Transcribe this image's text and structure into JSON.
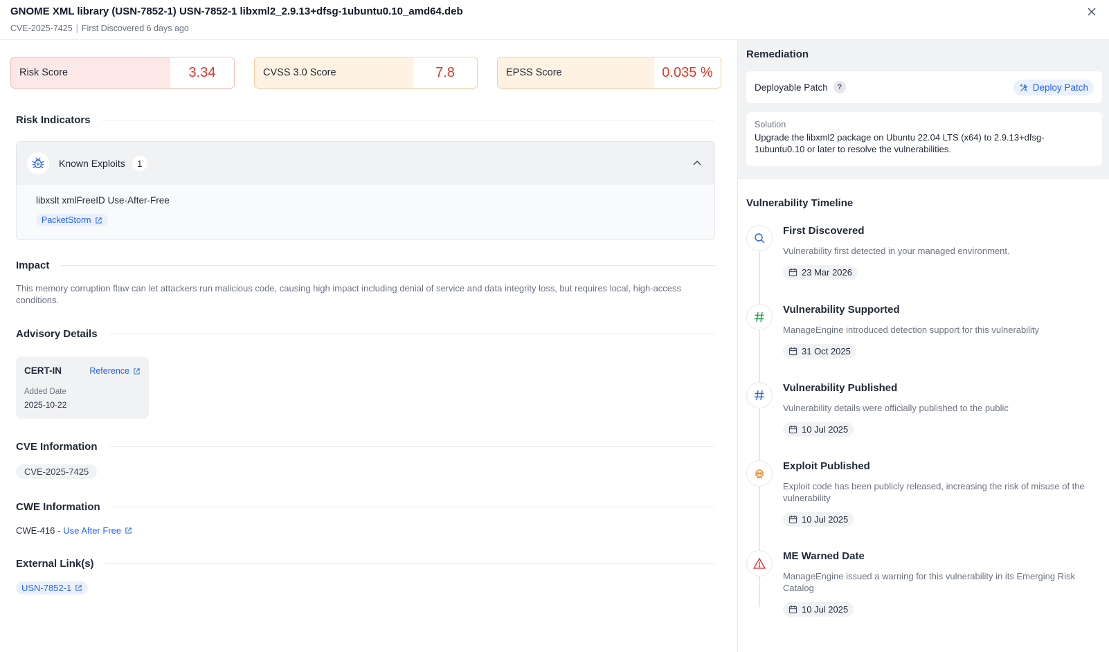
{
  "header": {
    "title": "GNOME XML library (USN-7852-1) USN-7852-1 libxml2_2.9.13+dfsg-1ubuntu0.10_amd64.deb",
    "cve_id": "CVE-2025-7425",
    "separator": "|",
    "discovered": "First Discovered 6 days ago",
    "close_icon": "close-icon"
  },
  "scores": {
    "risk": {
      "label": "Risk Score",
      "value": "3.34"
    },
    "cvss": {
      "label": "CVSS 3.0 Score",
      "value": "7.8"
    },
    "epss": {
      "label": "EPSS Score",
      "value": "0.035 %"
    },
    "colors": {
      "value": "#d93a2b",
      "risk_bg": "#fce8e6",
      "warn_bg": "#fef3e2"
    }
  },
  "risk_indicators": {
    "title": "Risk Indicators",
    "known_exploits": {
      "label": "Known Exploits",
      "count": "1",
      "icon": "bug-icon",
      "items": [
        {
          "title": "libxslt xmlFreeID Use-After-Free",
          "source": "PacketStorm"
        }
      ]
    }
  },
  "impact": {
    "title": "Impact",
    "text": "This memory corruption flaw can let attackers run malicious code, causing high impact including denial of service and data integrity loss, but requires local, high-access conditions."
  },
  "advisory": {
    "title": "Advisory Details",
    "items": [
      {
        "org": "CERT-IN",
        "link_label": "Reference",
        "date_label": "Added Date",
        "date": "2025-10-22"
      }
    ]
  },
  "cve_info": {
    "title": "CVE Information",
    "ids": [
      "CVE-2025-7425"
    ]
  },
  "cwe_info": {
    "title": "CWE Information",
    "id": "CWE-416 -",
    "name": "Use After Free"
  },
  "external_links": {
    "title": "External Link(s)",
    "links": [
      "USN-7852-1"
    ]
  },
  "remediation": {
    "title": "Remediation",
    "patch_label": "Deployable Patch",
    "help": "?",
    "deploy_button": "Deploy Patch",
    "solution_label": "Solution",
    "solution_text": "Upgrade the libxml2 package on Ubuntu 22.04 LTS (x64) to 2.9.13+dfsg-1ubuntu0.10 or later to resolve the vulnerabilities."
  },
  "timeline": {
    "title": "Vulnerability Timeline",
    "items": [
      {
        "title": "First Discovered",
        "desc": "Vulnerability first detected in your managed environment.",
        "date": "23 Mar 2026",
        "icon": "search-icon",
        "color": "#2563eb"
      },
      {
        "title": "Vulnerability Supported",
        "desc": "ManageEngine introduced detection support for this vulnerability",
        "date": "31 Oct 2025",
        "icon": "hash-icon",
        "color": "#16a34a"
      },
      {
        "title": "Vulnerability Published",
        "desc": "Vulnerability details were officially published to the public",
        "date": "10 Jul 2025",
        "icon": "hash-icon",
        "color": "#2563eb"
      },
      {
        "title": "Exploit Published",
        "desc": "Exploit code has been publicly released, increasing the risk of misuse of the vulnerability",
        "date": "10 Jul 2025",
        "icon": "skull-icon",
        "color": "#ea7c1e"
      },
      {
        "title": "ME Warned Date",
        "desc": "ManageEngine issued a warning for this vulnerability in its Emerging Risk Catalog",
        "date": "10 Jul 2025",
        "icon": "warning-icon",
        "color": "#dc2626"
      }
    ]
  }
}
